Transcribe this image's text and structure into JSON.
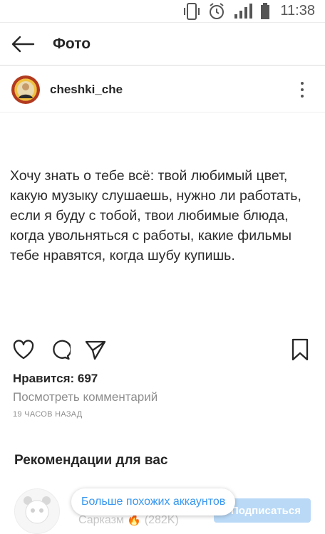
{
  "status_bar": {
    "time": "11:38",
    "icons": [
      "vibrate-icon",
      "alarm-icon",
      "signal-icon",
      "battery-icon"
    ]
  },
  "topbar": {
    "back_icon": "arrow-left-icon",
    "title": "Фото"
  },
  "post": {
    "username": "cheshki_che",
    "text": "Хочу знать о тебе всё: твой любимый цвет, какую музыку слушаешь, нужно ли работать, если я буду с тобой, твои любимые блюда, когда увольняться с работы, какие фильмы тебе нравятся, когда шубу купишь.",
    "likes": "Нравится: 697",
    "view_comments": "Посмотреть комментарий",
    "timestamp": "19 ЧАСОВ НАЗАД"
  },
  "recommendations": {
    "title": "Рекомендации для вас",
    "account_name": "Сарказм 🔥 (282K)",
    "subscribe_label": "Подписаться",
    "similar_accounts_label": "Больше похожих аккаунтов"
  },
  "colors": {
    "accent": "#3897f0",
    "text": "#262626",
    "muted": "#8e8e8e"
  }
}
